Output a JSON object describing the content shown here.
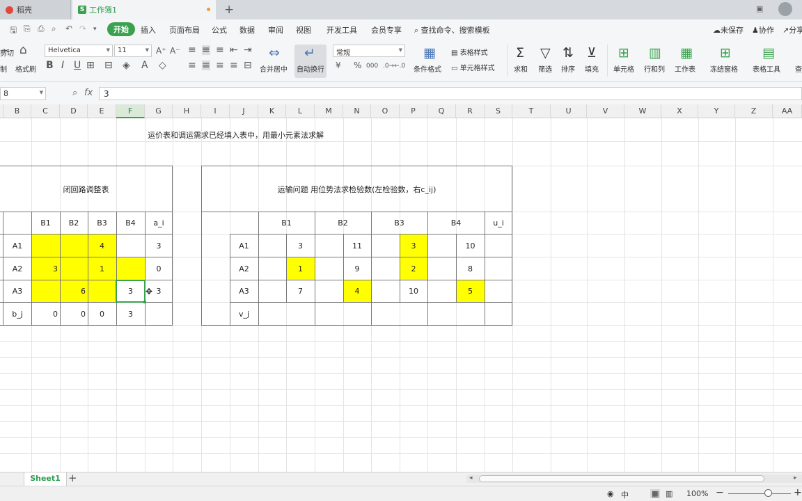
{
  "titlebar": {
    "tab1_label": "稻壳",
    "tab2_label": "工作簿1",
    "new_tab": "+"
  },
  "menubar": {
    "items": [
      "开始",
      "插入",
      "页面布局",
      "公式",
      "数据",
      "审阅",
      "视图",
      "开发工具",
      "会员专享"
    ],
    "search_label": "查找命令、搜索模板",
    "unsaved": "未保存",
    "collab": "协作",
    "share": "分享"
  },
  "toolbar": {
    "cut": "剪切",
    "brush": "格式刷",
    "font_name": "Helvetica",
    "font_size": "11",
    "merge": "合并居中",
    "wrap": "自动换行",
    "number_format": "常规",
    "table_style": "表格样式",
    "cond_format": "条件格式",
    "cell_style": "单元格样式",
    "sum": "求和",
    "filter": "筛选",
    "sort": "排序",
    "fill": "填充",
    "cell": "单元格",
    "rowcol": "行和列",
    "worksheet": "工作表",
    "freeze": "冻结窗格",
    "tabletools": "表格工具",
    "find": "查"
  },
  "formula": {
    "namebox": "8",
    "fx": "fx",
    "value": "3"
  },
  "columns": [
    "B",
    "C",
    "D",
    "E",
    "F",
    "G",
    "H",
    "I",
    "J",
    "K",
    "L",
    "M",
    "N",
    "O",
    "P",
    "Q",
    "R",
    "S",
    "T",
    "U",
    "V",
    "W",
    "X",
    "Y",
    "Z",
    "AA"
  ],
  "instruction": "运价表和调运需求已经填入表中，用最小元素法求解",
  "left_table": {
    "title": "闭回路调整表",
    "headers": [
      "B1",
      "B2",
      "B3",
      "B4",
      "a_i"
    ],
    "rows": [
      {
        "label": "A1",
        "cells": [
          "",
          "",
          "4",
          "",
          "3"
        ]
      },
      {
        "label": "A2",
        "cells": [
          "3",
          "",
          "1",
          "",
          "0"
        ]
      },
      {
        "label": "A3",
        "cells": [
          "",
          "6",
          "",
          "3",
          "3"
        ]
      },
      {
        "label": "b_j",
        "cells": [
          "0",
          "0",
          "0",
          "3",
          ""
        ]
      }
    ]
  },
  "right_table": {
    "title": "运输问题 用位势法求检验数(左检验数，右c_ij)",
    "headers": [
      "B1",
      "B2",
      "B3",
      "B4",
      "u_i"
    ],
    "rows": [
      {
        "label": "A1",
        "cells": [
          "",
          "3",
          "",
          "11",
          "3",
          "",
          "",
          "10"
        ]
      },
      {
        "label": "A2",
        "cells": [
          "1",
          "",
          "",
          "9",
          "2",
          "",
          "",
          "8"
        ]
      },
      {
        "label": "A3",
        "cells": [
          "",
          "7",
          "4",
          "",
          "",
          "10",
          "5",
          ""
        ]
      },
      {
        "label": "v_j",
        "cells": []
      }
    ]
  },
  "sheet_tabs": {
    "sheet1": "Sheet1",
    "add": "+"
  },
  "statusbar": {
    "zoom": "100%",
    "ime": "中"
  },
  "colors": {
    "accent": "#3aa24e",
    "highlight": "#ffff00"
  }
}
